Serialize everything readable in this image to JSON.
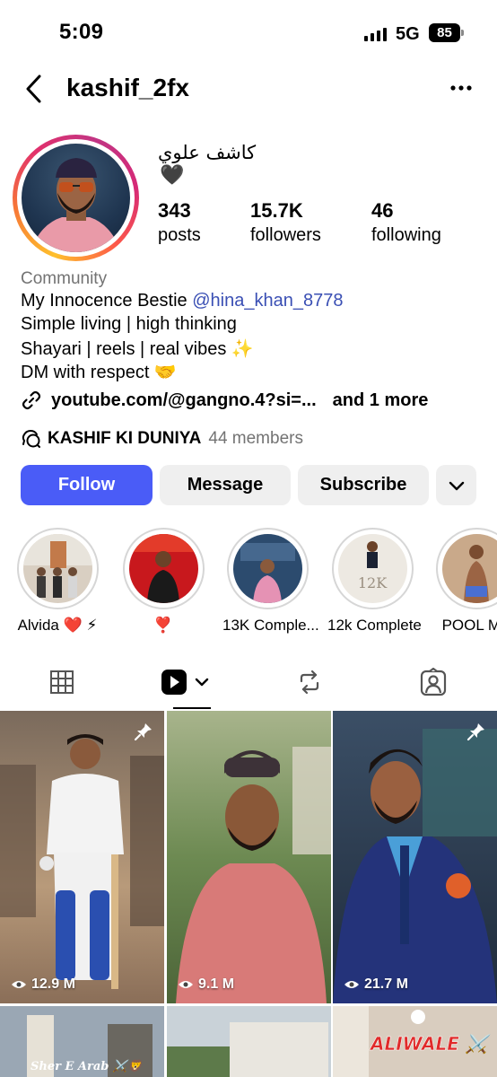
{
  "status_bar": {
    "time": "5:09",
    "network": "5G",
    "battery": "85"
  },
  "header": {
    "username": "kashif_2fx",
    "back_icon": "chevron-left-icon",
    "more_icon": "ellipsis-icon"
  },
  "profile": {
    "display_name": "كاشف علوي",
    "emoji": "🖤",
    "stats": [
      {
        "value": "343",
        "label": "posts"
      },
      {
        "value": "15.7K",
        "label": "followers"
      },
      {
        "value": "46",
        "label": "following"
      }
    ]
  },
  "bio": {
    "category": "Community",
    "line1_text": "My Innocence Bestie ",
    "line1_mention": "@hina_khan_8778",
    "line2": "Simple living | high thinking",
    "line3": "Shayari | reels | real vibes ✨",
    "line4": "DM with respect 🤝",
    "link": "youtube.com/@gangno.4?si=...",
    "link_more": "and 1 more",
    "channel_name": "KASHIF KI DUNIYA",
    "channel_members": "44 members"
  },
  "actions": {
    "follow": "Follow",
    "message": "Message",
    "subscribe": "Subscribe"
  },
  "highlights": [
    {
      "label": "Alvida ❤️ ⚡"
    },
    {
      "label": "❣️"
    },
    {
      "label": "13K Comple..."
    },
    {
      "label": "12k Complete"
    },
    {
      "label": "POOL MA"
    }
  ],
  "tabs": [
    {
      "name": "grid-icon"
    },
    {
      "name": "reels-icon"
    },
    {
      "name": "reposts-icon"
    },
    {
      "name": "tagged-icon"
    }
  ],
  "posts": [
    {
      "views": "12.9 M"
    },
    {
      "views": "9.1 M"
    },
    {
      "views": "21.7 M"
    }
  ],
  "post_captions": {
    "row2_left": "Sher E Arab ⚔️🦁",
    "row2_right": "ALIWALE ⚔️"
  },
  "colors": {
    "follow_button": "#4a5cf7",
    "mention": "#3a4fb4",
    "secondary_text": "#737373",
    "button_gray": "#efefef"
  }
}
